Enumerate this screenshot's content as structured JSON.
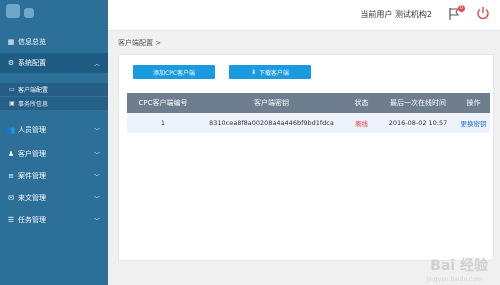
{
  "sidebar": {
    "items": [
      {
        "label": "信息总览",
        "icon": "dashboard-icon"
      },
      {
        "label": "系统配置",
        "icon": "gear-icon"
      },
      {
        "label": "人员管理",
        "icon": "people-icon"
      },
      {
        "label": "客户管理",
        "icon": "customer-icon"
      },
      {
        "label": "案件管理",
        "icon": "list-icon"
      },
      {
        "label": "来文管理",
        "icon": "mail-icon"
      },
      {
        "label": "任务管理",
        "icon": "task-icon"
      }
    ],
    "sub_items": [
      {
        "label": "客户端配置",
        "icon": "monitor-icon"
      },
      {
        "label": "事务所信息",
        "icon": "building-icon"
      }
    ]
  },
  "header": {
    "user_text": "当前用户  测试机构2",
    "notification_count": "0"
  },
  "breadcrumb": {
    "text": "客户端配置 >"
  },
  "toolbar": {
    "add_label": "添加CPC客户端",
    "download_label": "下载客户端",
    "download_icon": "⬇"
  },
  "table": {
    "headers": {
      "id": "CPC客户端编号",
      "key": "客户端密钥",
      "status": "状态",
      "last_online": "最后一次在线时间",
      "action": "操作"
    },
    "rows": [
      {
        "id": "1",
        "key": "8310cea8f8a00208a4a446bf9bd1fdca",
        "status": "离线",
        "last_online": "2016-08-02 10:57",
        "action": "更换密钥"
      }
    ]
  },
  "watermark": {
    "text": "Bai 经验",
    "sub": "jingyan.baidu.com"
  },
  "colors": {
    "sidebar_bg": "#2c6f98",
    "accent": "#1a9be0",
    "table_header": "#6f7e8f",
    "offline": "#e23a3a"
  }
}
